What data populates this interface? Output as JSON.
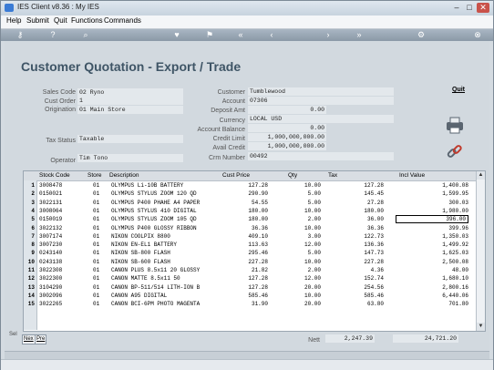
{
  "window": {
    "title": "IES Client v8.36 : My IES"
  },
  "menu": [
    "Help",
    "Submit",
    "Quit",
    "Functions",
    "Commands"
  ],
  "toolbar_icons": [
    "key-icon",
    "help-icon",
    "search-icon",
    "heart-icon",
    "flag-icon",
    "rewind-icon",
    "back-icon",
    "forward-icon",
    "fast-forward-icon",
    "settings-icon",
    "close-icon"
  ],
  "page": {
    "heading": "Customer Quotation - Export / Trade",
    "quit_link": "Quit"
  },
  "form": {
    "sales_code_label": "Sales Code",
    "sales_code": "02 Ryno",
    "cust_order_label": "Cust Order",
    "cust_order": "1",
    "origination_label": "Origination",
    "origination": "01 Main Store",
    "tax_status_label": "Tax Status",
    "tax_status": "Taxable",
    "operator_label": "Operator",
    "operator": "Tim Tono",
    "customer_label": "Customer",
    "customer": "Tumblewood",
    "account_label": "Account",
    "account": "07306",
    "deposit_label": "Deposit Amt",
    "deposit": "0.00",
    "currency_label": "Currency",
    "currency": "LOCAL USD",
    "account_balance_label": "Account Balance",
    "account_balance": "0.00",
    "credit_limit_label": "Credit Limit",
    "credit_limit": "1,000,000,000.00",
    "avail_credit_label": "Avail Credit",
    "avail_credit": "1,000,000,000.00",
    "crm_label": "Crm Number",
    "crm": "00492"
  },
  "grid": {
    "headers": [
      "Stock Code",
      "Store",
      "Description",
      "Cust Price",
      "Qty",
      "Tax",
      "Incl Value"
    ],
    "rows": [
      {
        "n": "1",
        "code": "3008478",
        "store": "01",
        "desc": "OLYMPUS Li-10B BATTERY",
        "price": "127.28",
        "qty": "10.00",
        "tax": "127.28",
        "incl": "1,400.08"
      },
      {
        "n": "2",
        "code": "0150021",
        "store": "01",
        "desc": "OLYMPUS STYLUS ZOOM 120 QD",
        "price": "290.90",
        "qty": "5.00",
        "tax": "145.45",
        "incl": "1,599.95"
      },
      {
        "n": "3",
        "code": "3022131",
        "store": "01",
        "desc": "OLYMPUS P400 PHAHE A4 PAPER",
        "price": "54.55",
        "qty": "5.00",
        "tax": "27.28",
        "incl": "300.03"
      },
      {
        "n": "4",
        "code": "3008064",
        "store": "01",
        "desc": "OLYMPUS STYLUS 410 DIGITAL",
        "price": "180.00",
        "qty": "10.00",
        "tax": "180.00",
        "incl": "1,980.00"
      },
      {
        "n": "5",
        "code": "0150019",
        "store": "01",
        "desc": "OLYMPUS STYLUS ZOOM 105 QD",
        "price": "180.00",
        "qty": "2.00",
        "tax": "36.00",
        "incl": "396.00"
      },
      {
        "n": "6",
        "code": "3022132",
        "store": "01",
        "desc": "OLYMPUS P400 GLOSSY RIBBON",
        "price": "36.36",
        "qty": "10.00",
        "tax": "36.36",
        "incl": "399.96"
      },
      {
        "n": "7",
        "code": "3007174",
        "store": "01",
        "desc": "NIKON COOLPIX 8800",
        "price": "409.10",
        "qty": "3.00",
        "tax": "122.73",
        "incl": "1,350.03"
      },
      {
        "n": "8",
        "code": "3007230",
        "store": "01",
        "desc": "NIKON EN-EL1 BATTERY",
        "price": "113.63",
        "qty": "12.00",
        "tax": "136.36",
        "incl": "1,499.92"
      },
      {
        "n": "9",
        "code": "0243140",
        "store": "01",
        "desc": "NIKON SB-800 FLASH",
        "price": "295.46",
        "qty": "5.00",
        "tax": "147.73",
        "incl": "1,625.03"
      },
      {
        "n": "10",
        "code": "0243138",
        "store": "01",
        "desc": "NIKON SB-600 FLASH",
        "price": "227.28",
        "qty": "10.00",
        "tax": "227.28",
        "incl": "2,500.08"
      },
      {
        "n": "11",
        "code": "3022308",
        "store": "01",
        "desc": "CANON PLUS 8.5x11 20 GLOSSY",
        "price": "21.82",
        "qty": "2.00",
        "tax": "4.36",
        "incl": "48.00"
      },
      {
        "n": "12",
        "code": "3022300",
        "store": "01",
        "desc": "CANON MATTE 8.5x11 50",
        "price": "127.28",
        "qty": "12.00",
        "tax": "152.74",
        "incl": "1,680.10"
      },
      {
        "n": "13",
        "code": "3104290",
        "store": "01",
        "desc": "CANON BP-511/514 LITH-ION B",
        "price": "127.28",
        "qty": "20.00",
        "tax": "254.56",
        "incl": "2,800.16"
      },
      {
        "n": "14",
        "code": "3002096",
        "store": "01",
        "desc": "CANON A95 DIGITAL",
        "price": "585.46",
        "qty": "10.00",
        "tax": "585.46",
        "incl": "6,440.06"
      },
      {
        "n": "15",
        "code": "3022265",
        "store": "01",
        "desc": "CANON BCI-6PM PHOTO MAGENTA",
        "price": "31.90",
        "qty": "20.00",
        "tax": "63.80",
        "incl": "701.80"
      }
    ]
  },
  "pager": {
    "next": "Nex",
    "prev": "Pre",
    "sel": "Sel"
  },
  "totals": {
    "nett_label": "Nett",
    "nett": "2,247.39",
    "total": "24,721.20"
  }
}
